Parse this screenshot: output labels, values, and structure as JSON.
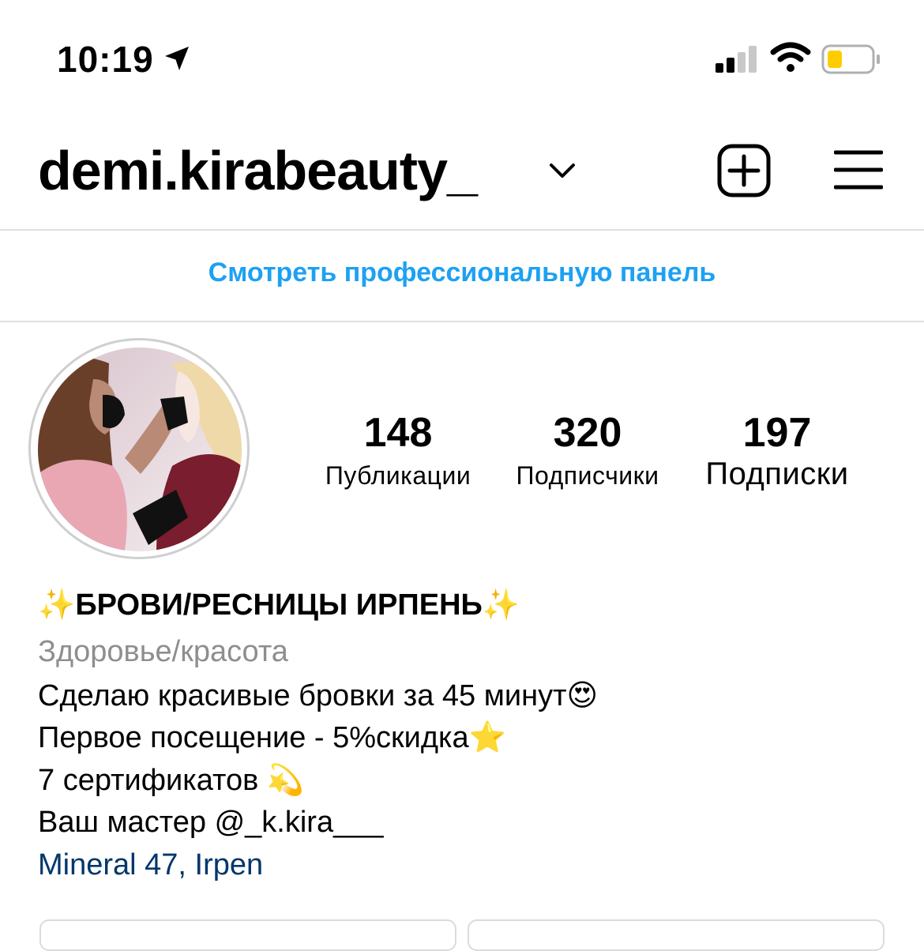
{
  "status_bar": {
    "time": "10:19"
  },
  "header": {
    "username": "demi.kirabeauty_"
  },
  "pro_dashboard": {
    "label": "Смотреть профессиональную панель"
  },
  "stats": {
    "posts": {
      "value": "148",
      "label": "Публикации"
    },
    "followers": {
      "value": "320",
      "label": "Подписчики"
    },
    "following": {
      "value": "197",
      "label": "Подписки"
    }
  },
  "bio": {
    "name": "✨БРОВИ/РЕСНИЦЫ  ИРПЕНЬ✨",
    "category": "Здоровье/красота",
    "line1": "Сделаю красивые бровки за 45 минут😍",
    "line2": "Первое посещение - 5%скидка⭐️",
    "line3": "7 сертификатов 💫",
    "line4": "Ваш мастер @_k.kira___",
    "location": "Mineral 47, Irpen"
  },
  "icons": {
    "location_arrow": "location-arrow-icon",
    "signal": "cellular-signal-icon",
    "wifi": "wifi-icon",
    "battery": "battery-icon",
    "chevron": "chevron-down-icon",
    "new_post": "plus-square-icon",
    "menu": "hamburger-menu-icon"
  },
  "colors": {
    "link_blue": "#1da1f2",
    "location_blue": "#00376b",
    "battery_fill": "#ffcc00",
    "category_gray": "#8e8e8e"
  }
}
